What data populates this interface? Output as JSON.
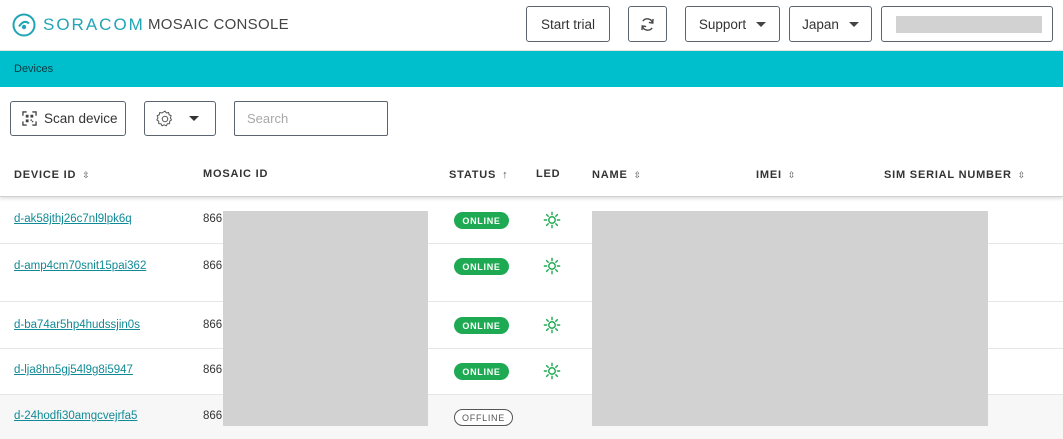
{
  "header": {
    "brand_name": "SORACOM",
    "console_name": "MOSAIC CONSOLE",
    "start_trial_label": "Start trial",
    "refresh_icon": "refresh-icon",
    "support_label": "Support",
    "region_label": "Japan",
    "user_menu_value": ""
  },
  "breadcrumb": {
    "label": "Devices"
  },
  "toolbar": {
    "scan_label": "Scan device",
    "settings_icon": "gear-icon",
    "search_placeholder": "Search"
  },
  "table": {
    "columns": [
      {
        "key": "device_id",
        "label": "DEVICE ID",
        "sort": "⇳"
      },
      {
        "key": "mosaic_id",
        "label": "MOSAIC ID",
        "sort": ""
      },
      {
        "key": "status",
        "label": "STATUS",
        "sort": "↑"
      },
      {
        "key": "led",
        "label": "LED",
        "sort": ""
      },
      {
        "key": "name",
        "label": "NAME",
        "sort": "⇳"
      },
      {
        "key": "imei",
        "label": "IMEI",
        "sort": "⇳"
      },
      {
        "key": "sim",
        "label": "SIM SERIAL NUMBER",
        "sort": "⇳"
      }
    ],
    "rows": [
      {
        "device_id": "d-ak58jthj26c7nl9lpk6q",
        "mosaic_id": "866",
        "status": "ONLINE",
        "led": true
      },
      {
        "device_id": "d-amp4cm70snit15pai362",
        "mosaic_id": "866",
        "status": "ONLINE",
        "led": true
      },
      {
        "device_id": "d-ba74ar5hp4hudssjin0s",
        "mosaic_id": "866",
        "status": "ONLINE",
        "led": true
      },
      {
        "device_id": "d-lja8hn5gj54l9g8i5947",
        "mosaic_id": "866",
        "status": "ONLINE",
        "led": true
      },
      {
        "device_id": "d-24hodfi30amgcvejrfa5",
        "mosaic_id": "866",
        "status": "OFFLINE",
        "led": false
      }
    ]
  },
  "colors": {
    "accent": "#00bfcc",
    "brand": "#21a5b5",
    "link": "#108a96",
    "online": "#1eaa52",
    "led": "#1eaa52"
  }
}
